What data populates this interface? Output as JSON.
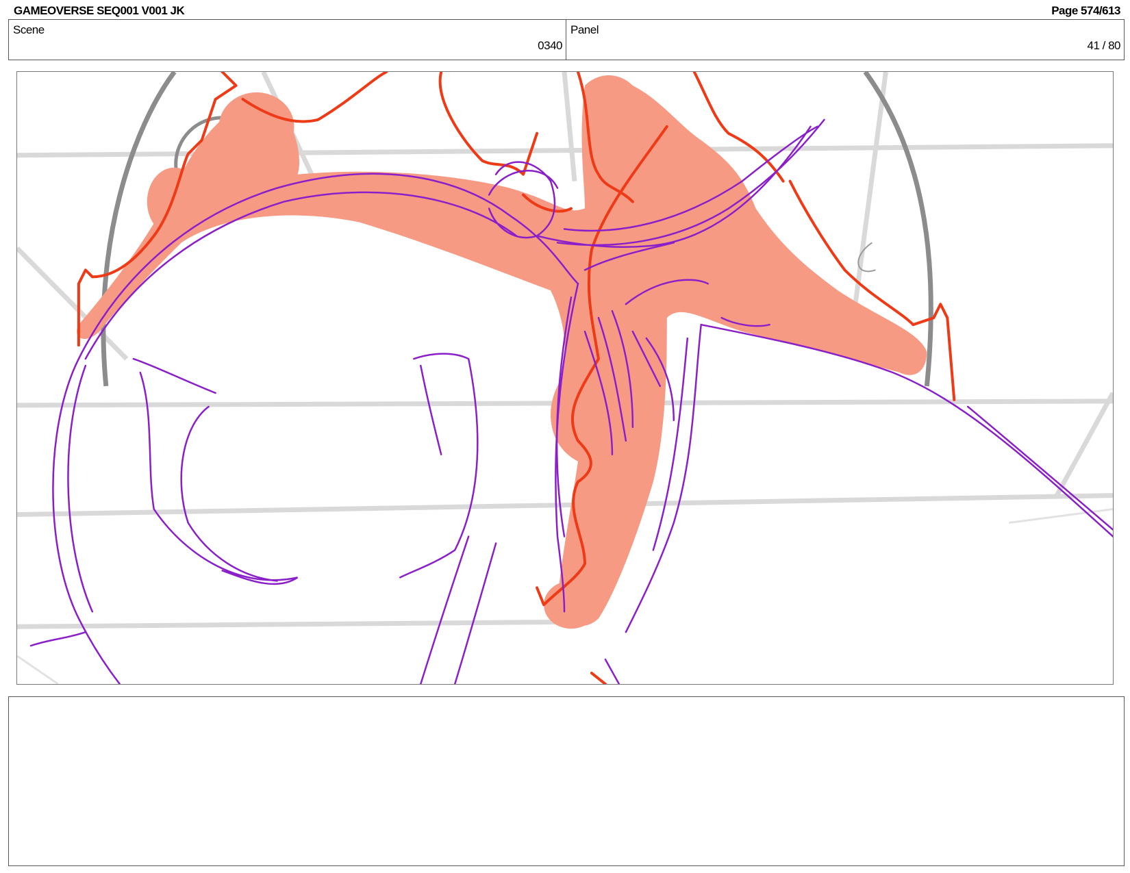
{
  "header": {
    "title": "GAMEOVERSE SEQ001 V001 JK",
    "page": "Page 574/613"
  },
  "info": {
    "scene_label": "Scene",
    "scene_value": "0340",
    "panel_label": "Panel",
    "panel_value": "41 / 80"
  },
  "notes": {
    "text": ""
  },
  "colors": {
    "fill_salmon": "#f79a84",
    "line_red": "#ee3a16",
    "line_purple": "#8a1fc9",
    "line_grey": "#8c8c8c",
    "guide_grey": "#d9d9d9"
  }
}
